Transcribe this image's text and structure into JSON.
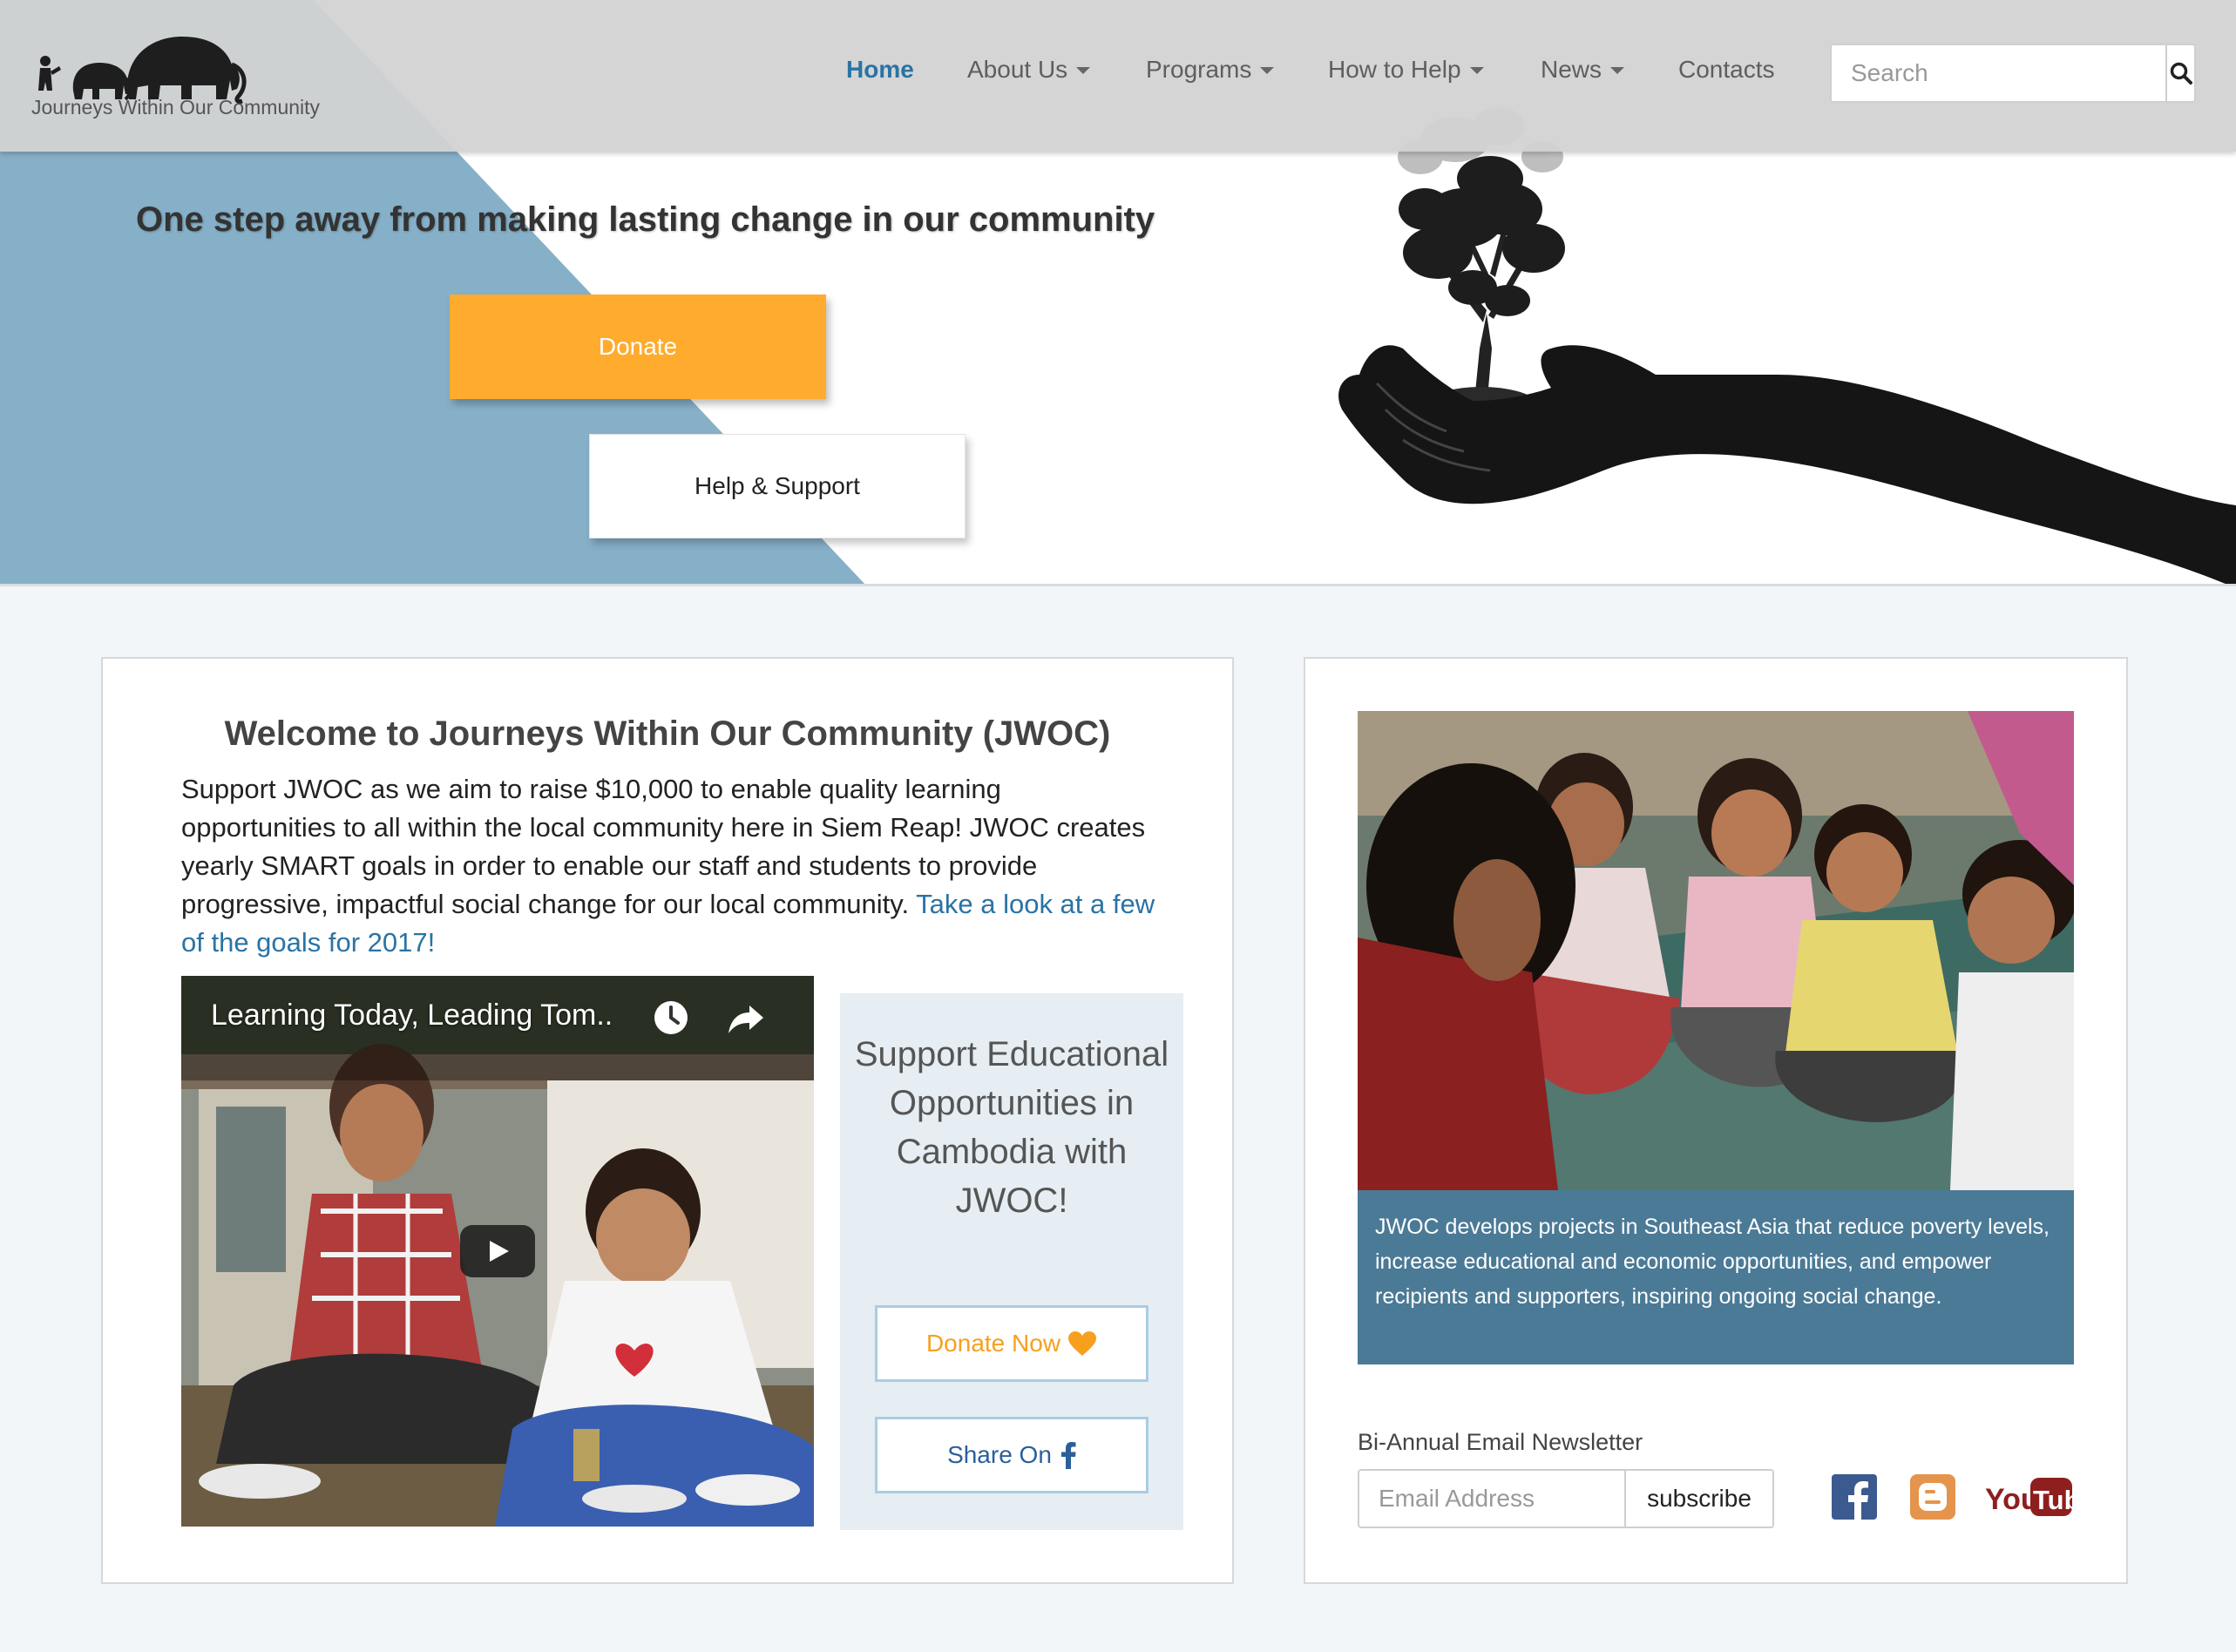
{
  "header": {
    "logo_text": "Journeys Within Our Community",
    "nav": [
      {
        "label": "Home",
        "active": true,
        "dropdown": false
      },
      {
        "label": "About Us",
        "active": false,
        "dropdown": true
      },
      {
        "label": "Programs",
        "active": false,
        "dropdown": true
      },
      {
        "label": "How to Help",
        "active": false,
        "dropdown": true
      },
      {
        "label": "News",
        "active": false,
        "dropdown": true
      },
      {
        "label": "Contacts",
        "active": false,
        "dropdown": false
      }
    ],
    "search_placeholder": "Search"
  },
  "hero": {
    "headline": "One step away from making lasting change in our community",
    "donate_label": "Donate",
    "help_label": "Help & Support"
  },
  "welcome": {
    "title": "Welcome to Journeys Within Our Community (JWOC)",
    "body": "Support JWOC as we aim to raise $10,000 to enable quality learning opportunities to all within the local community here in Siem Reap! JWOC creates yearly SMART goals in order to enable our staff and students to provide progressive, impactful social change for our local community.",
    "link_text": "Take a look at a few of the goals for 2017!"
  },
  "video": {
    "title": "Learning Today, Leading Tom.."
  },
  "support": {
    "heading": "Support Educational Opportunities in Cambodia with JWOC!",
    "donate_now_label": "Donate Now",
    "share_label": "Share On"
  },
  "about": {
    "caption": "JWOC develops projects in Southeast Asia that reduce poverty levels, increase educational and economic opportunities, and empower recipients and supporters, inspiring ongoing social change."
  },
  "newsletter": {
    "label": "Bi-Annual Email Newsletter",
    "email_placeholder": "Email Address",
    "subscribe_label": "subscribe"
  },
  "social": [
    "facebook-icon",
    "blogger-icon",
    "youtube-icon"
  ],
  "colors": {
    "accent": "#2a73a4",
    "donate": "#ffab2e",
    "hero_blue": "#86b0c8",
    "caption_bg": "#4b7a96"
  }
}
